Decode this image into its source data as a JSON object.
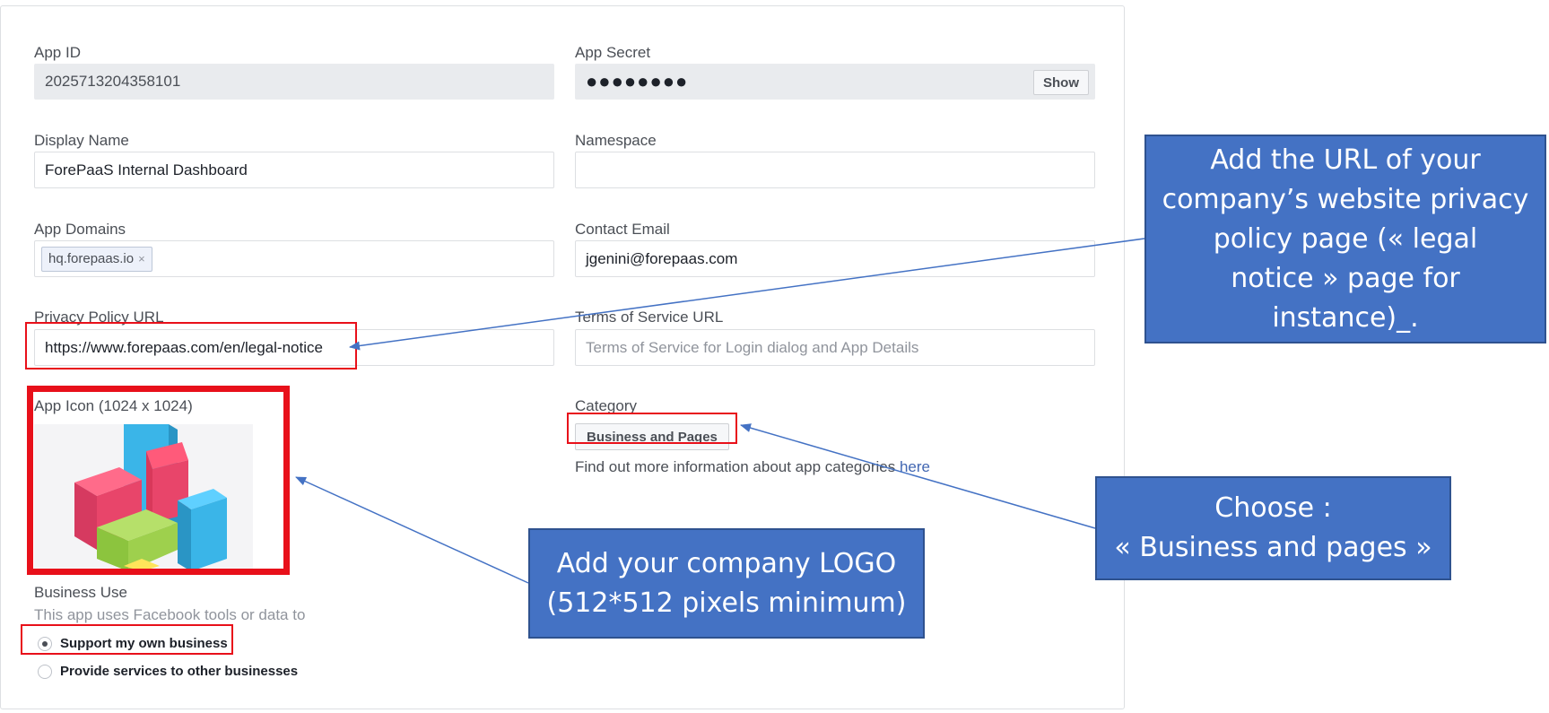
{
  "form": {
    "app_id": {
      "label": "App ID",
      "value": "2025713204358101"
    },
    "app_secret": {
      "label": "App Secret",
      "value": "●●●●●●●●",
      "show_label": "Show"
    },
    "display_name": {
      "label": "Display Name",
      "value": "ForePaaS Internal Dashboard"
    },
    "namespace": {
      "label": "Namespace",
      "value": ""
    },
    "app_domains": {
      "label": "App Domains",
      "tag": "hq.forepaas.io",
      "tag_remove": "×"
    },
    "contact_email": {
      "label": "Contact Email",
      "value": "jgenini@forepaas.com"
    },
    "privacy_policy": {
      "label": "Privacy Policy URL",
      "value": "https://www.forepaas.com/en/legal-notice"
    },
    "terms_of_service": {
      "label": "Terms of Service URL",
      "placeholder": "Terms of Service for Login dialog and App Details"
    },
    "app_icon": {
      "label": "App Icon (1024 x 1024)"
    },
    "category": {
      "label": "Category",
      "selected": "Business and Pages",
      "info_text": "Find out more information about app categories",
      "info_link": "here"
    },
    "business_use": {
      "label": "Business Use",
      "description": "This app uses Facebook tools or data to",
      "options": [
        "Support my own business",
        "Provide services to other businesses"
      ],
      "selected_index": 0
    }
  },
  "annotations": {
    "privacy_callout": [
      "Add the URL of your",
      "company’s website privacy",
      "policy page (« legal",
      "notice » page for",
      "instance)_."
    ],
    "category_callout": [
      "Choose :",
      "« Business and pages »"
    ],
    "logo_callout": [
      "Add your company LOGO",
      "(512*512 pixels minimum)"
    ]
  },
  "colors": {
    "highlight_red": "#e8101a",
    "callout_blue": "#4472c4",
    "link_blue": "#4267b2"
  }
}
